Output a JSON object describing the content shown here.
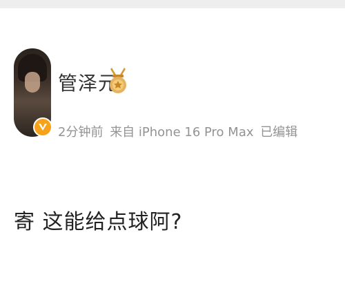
{
  "post": {
    "author": {
      "name": "管泽元",
      "avatar_icon": "user-avatar",
      "verified_icon": "verified-badge-icon",
      "medal_icon": "gold-medal-icon"
    },
    "meta": {
      "time": "2分钟前",
      "source": "来自 iPhone 16 Pro Max",
      "edited": "已编辑"
    },
    "text": "寄 这能给点球阿?"
  },
  "colors": {
    "name": "#333333",
    "meta": "#939393",
    "badge": "#f7a21b",
    "medal": "#e0a24a"
  }
}
